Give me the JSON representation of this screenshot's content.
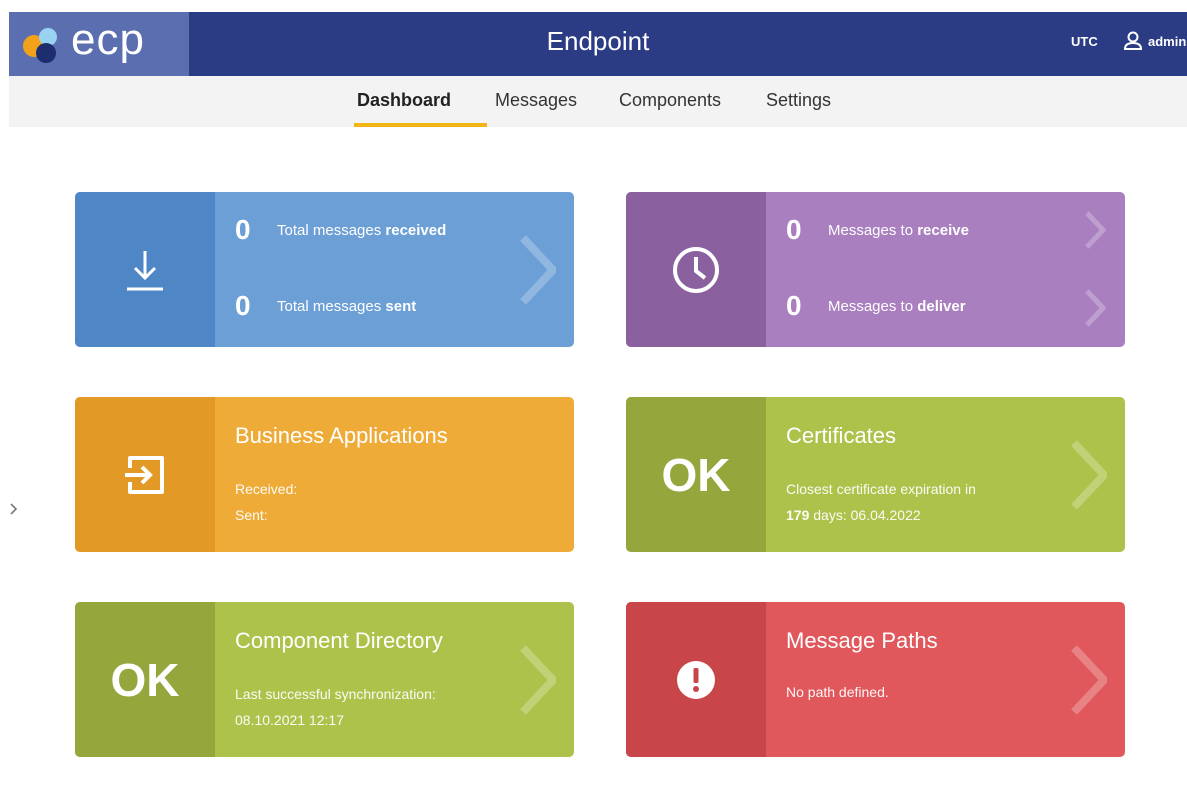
{
  "app": {
    "logo_text": "ecp",
    "title": "Endpoint",
    "timezone": "UTC",
    "user": "admin"
  },
  "nav": {
    "tabs": [
      {
        "label": "Dashboard",
        "active": true
      },
      {
        "label": "Messages",
        "active": false
      },
      {
        "label": "Components",
        "active": false
      },
      {
        "label": "Settings",
        "active": false
      }
    ]
  },
  "tiles": {
    "messages": {
      "received_count": "0",
      "received_text": "Total messages",
      "received_bold": "received",
      "sent_count": "0",
      "sent_text": "Total messages",
      "sent_bold": "sent",
      "icon": "download-icon"
    },
    "queue": {
      "to_receive_count": "0",
      "to_receive_text": "Messages to",
      "to_receive_bold": "receive",
      "to_deliver_count": "0",
      "to_deliver_text": "Messages to",
      "to_deliver_bold": "deliver",
      "icon": "clock-icon"
    },
    "business": {
      "title": "Business Applications",
      "received_label": "Received:",
      "sent_label": "Sent:",
      "icon": "login-icon"
    },
    "certificates": {
      "status": "OK",
      "title": "Certificates",
      "line1": "Closest certificate expiration in",
      "days": "179",
      "line2_rest": "days: 06.04.2022"
    },
    "directory": {
      "status": "OK",
      "title": "Component Directory",
      "line1": "Last successful synchronization:",
      "line2": "08.10.2021 12:17"
    },
    "paths": {
      "title": "Message Paths",
      "line1": "No path defined.",
      "icon": "alert-icon"
    }
  },
  "colors": {
    "header": "#2b3c85",
    "accent": "#f2b614",
    "blue": "#6b9fd6",
    "purple": "#a97fc0",
    "orange": "#eeab38",
    "green": "#adc24a",
    "red": "#e0585c"
  }
}
